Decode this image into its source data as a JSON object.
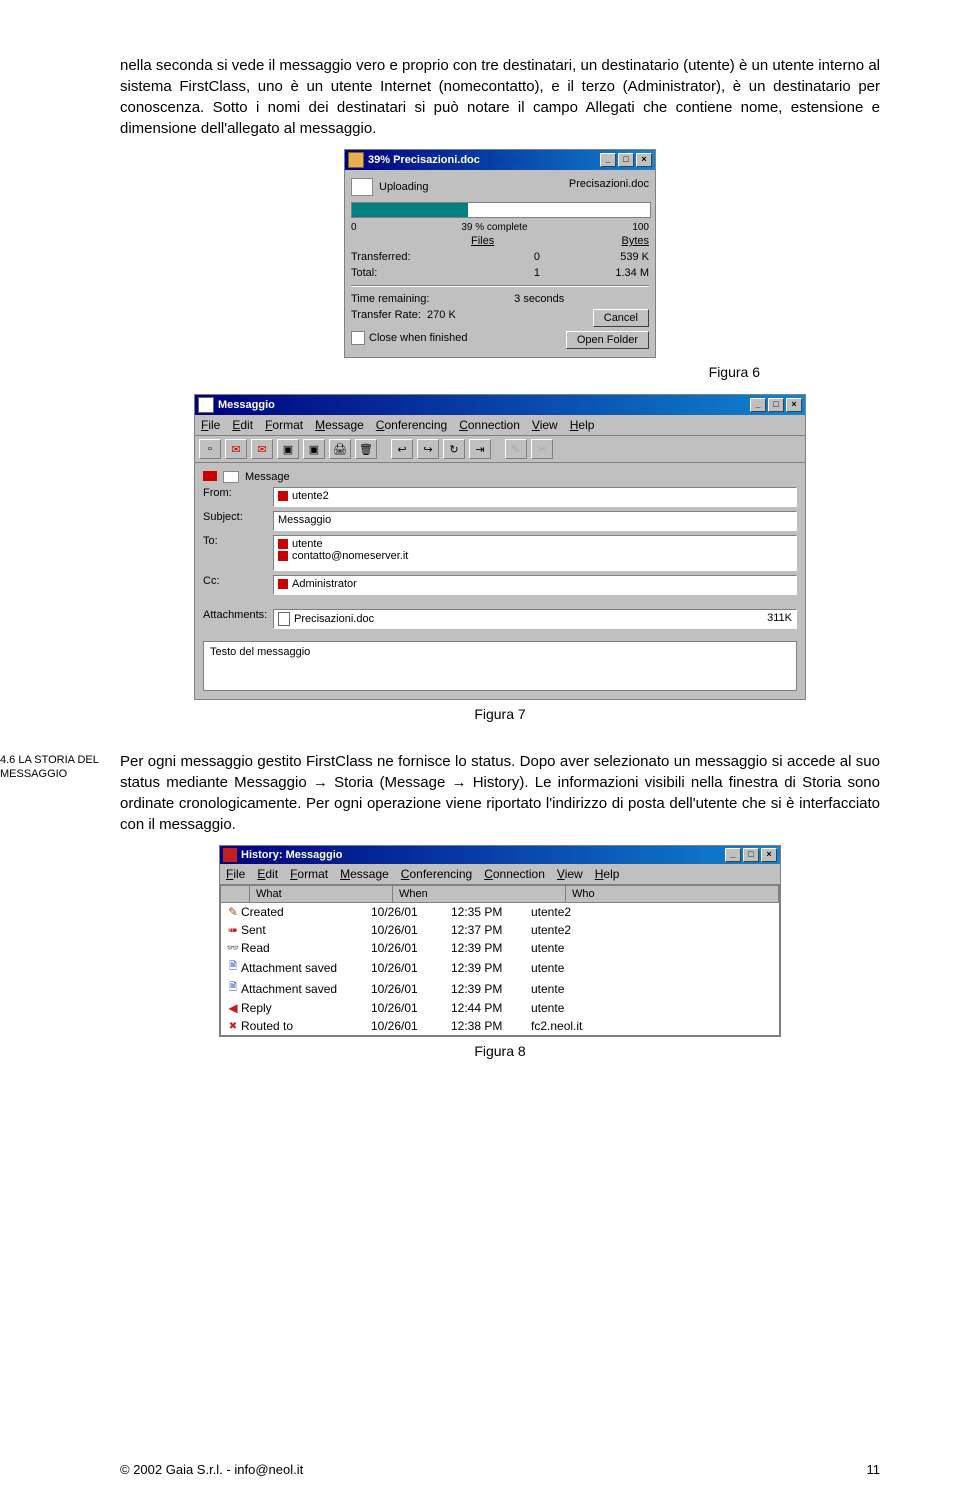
{
  "paragraphs": {
    "intro": "nella seconda si vede il messaggio vero e proprio con tre destinatari, un destinatario (utente) è un utente interno al sistema FirstClass, uno è un utente Internet (nomecontatto), e il terzo (Administrator), è un destinatario per conoscenza. Sotto i nomi dei destinatari si può notare il campo Allegati che contiene nome, estensione e dimensione dell'allegato al messaggio.",
    "storia": "Per ogni messaggio gestito FirstClass ne fornisce lo status. Dopo aver selezionato un messaggio si accede al suo status mediante Messaggio → Storia (Message → History). Le informazioni visibili nella finestra di Storia sono ordinate cronologicamente. Per ogni operazione viene riportato l'indirizzo di posta dell'utente che si è interfacciato con il messaggio."
  },
  "side": {
    "storia_label": "4.6 LA STORIA DEL MESSAGGIO"
  },
  "captions": {
    "fig6": "Figura 6",
    "fig7": "Figura 7",
    "fig8": "Figura 8"
  },
  "progress": {
    "title": "39% Precisazioni.doc",
    "uploading": "Uploading",
    "file": "Precisazioni.doc",
    "pct_label": "39  % complete",
    "scale_lo": "0",
    "scale_hi": "100",
    "files_h": "Files",
    "bytes_h": "Bytes",
    "transferred_l": "Transferred:",
    "transferred_files": "0",
    "transferred_bytes": "539 K",
    "total_l": "Total:",
    "total_files": "1",
    "total_bytes": "1.34 M",
    "time_l": "Time remaining:",
    "time_v": "3 seconds",
    "rate_l": "Transfer Rate:",
    "rate_v": "270 K",
    "close_cb": "Close when finished",
    "cancel": "Cancel",
    "open_folder": "Open Folder"
  },
  "msg": {
    "title": "Messaggio",
    "menu": [
      "File",
      "Edit",
      "Format",
      "Message",
      "Conferencing",
      "Connection",
      "View",
      "Help"
    ],
    "flag_badge": "Message",
    "from_l": "From:",
    "from_v": "utente2",
    "subject_l": "Subject:",
    "subject_v": "Messaggio",
    "to_l": "To:",
    "to_v1": "utente",
    "to_v2": "contatto@nomeserver.it",
    "cc_l": "Cc:",
    "cc_v": "Administrator",
    "attach_l": "Attachments:",
    "attach_name": "Precisazioni.doc",
    "attach_size": "311K",
    "body": "Testo del messaggio"
  },
  "hist": {
    "title": "History: Messaggio",
    "menu": [
      "File",
      "Edit",
      "Format",
      "Message",
      "Conferencing",
      "Connection",
      "View",
      "Help"
    ],
    "cols": [
      "What",
      "When",
      "Who"
    ],
    "rows": [
      {
        "ic": "ic-pencil",
        "what": "Created",
        "date": "10/26/01",
        "time": "12:35 PM",
        "who": "utente2"
      },
      {
        "ic": "ic-sent",
        "what": "Sent",
        "date": "10/26/01",
        "time": "12:37 PM",
        "who": "utente2"
      },
      {
        "ic": "ic-read",
        "what": "Read",
        "date": "10/26/01",
        "time": "12:39 PM",
        "who": "utente"
      },
      {
        "ic": "ic-save",
        "what": "Attachment saved",
        "date": "10/26/01",
        "time": "12:39 PM",
        "who": "utente"
      },
      {
        "ic": "ic-save",
        "what": "Attachment saved",
        "date": "10/26/01",
        "time": "12:39 PM",
        "who": "utente"
      },
      {
        "ic": "ic-reply",
        "what": "Reply",
        "date": "10/26/01",
        "time": "12:44 PM",
        "who": "utente"
      },
      {
        "ic": "ic-route",
        "what": "Routed to",
        "date": "10/26/01",
        "time": "12:38 PM",
        "who": "fc2.neol.it"
      }
    ]
  },
  "footer": {
    "left": "© 2002 Gaia S.r.l. - info@neol.it",
    "right": "11"
  }
}
